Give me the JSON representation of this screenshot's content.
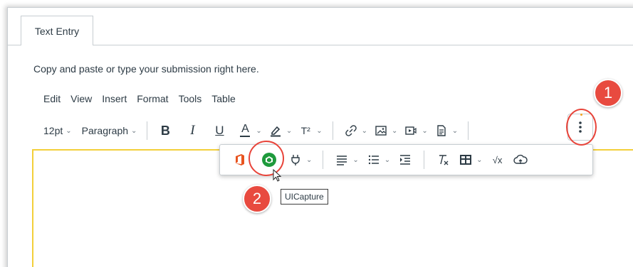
{
  "tab": {
    "label": "Text Entry"
  },
  "instructions": "Copy and paste or type your submission right here.",
  "menubar": [
    "Edit",
    "View",
    "Insert",
    "Format",
    "Tools",
    "Table"
  ],
  "toolbar": {
    "font_size": "12pt",
    "block_format": "Paragraph",
    "bold": "B",
    "italic": "I",
    "underline": "U",
    "text_color": "A",
    "superscript": "T²"
  },
  "popover": {
    "sqrt": "√x"
  },
  "tooltip": "UICapture",
  "badges": {
    "one": "1",
    "two": "2"
  },
  "colors": {
    "accent": "#e8443a",
    "editor_border": "#f3cf3a",
    "uicapture": "#1e9a3c",
    "office": "#e8541f"
  }
}
